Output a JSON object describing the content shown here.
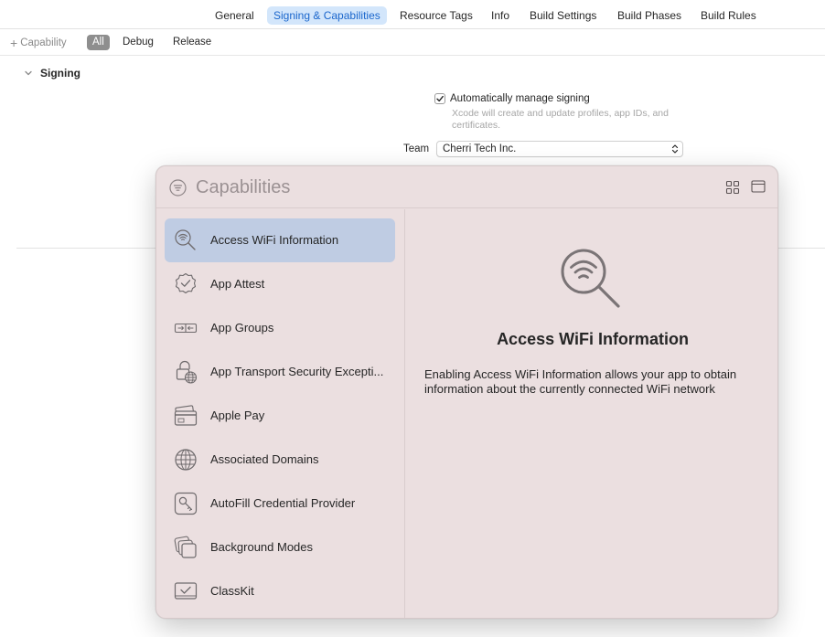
{
  "tabs": [
    {
      "label": "General"
    },
    {
      "label": "Signing & Capabilities",
      "selected": true
    },
    {
      "label": "Resource Tags"
    },
    {
      "label": "Info"
    },
    {
      "label": "Build Settings"
    },
    {
      "label": "Build Phases"
    },
    {
      "label": "Build Rules"
    }
  ],
  "filterbar": {
    "add_capability": "Capability",
    "segments": [
      "All",
      "Debug",
      "Release"
    ],
    "active_segment": "All"
  },
  "signing": {
    "section_title": "Signing",
    "auto_manage_label": "Automatically manage signing",
    "auto_manage_checked": true,
    "auto_manage_desc": "Xcode will create and update profiles, app IDs, and certificates.",
    "team_label": "Team",
    "team_value": "Cherri Tech Inc."
  },
  "popup": {
    "search_placeholder": "Capabilities",
    "items": [
      {
        "label": "Access WiFi Information",
        "icon": "wifi-search-icon",
        "selected": true
      },
      {
        "label": "App Attest",
        "icon": "attest-seal-icon"
      },
      {
        "label": "App Groups",
        "icon": "app-groups-icon"
      },
      {
        "label": "App Transport Security Excepti...",
        "icon": "lock-globe-icon"
      },
      {
        "label": "Apple Pay",
        "icon": "credit-card-icon"
      },
      {
        "label": "Associated Domains",
        "icon": "globe-icon"
      },
      {
        "label": "AutoFill Credential Provider",
        "icon": "key-icon"
      },
      {
        "label": "Background Modes",
        "icon": "stacked-squares-icon"
      },
      {
        "label": "ClassKit",
        "icon": "classkit-icon"
      }
    ],
    "detail": {
      "title": "Access WiFi Information",
      "description": "Enabling Access WiFi Information allows your app to obtain information about the currently connected WiFi network"
    }
  },
  "colors": {
    "accent": "#1a66cc",
    "selected_tab_bg": "#d3e6fb",
    "popup_bg": "#ebdfe0",
    "selected_row_bg": "#bfcce3"
  }
}
